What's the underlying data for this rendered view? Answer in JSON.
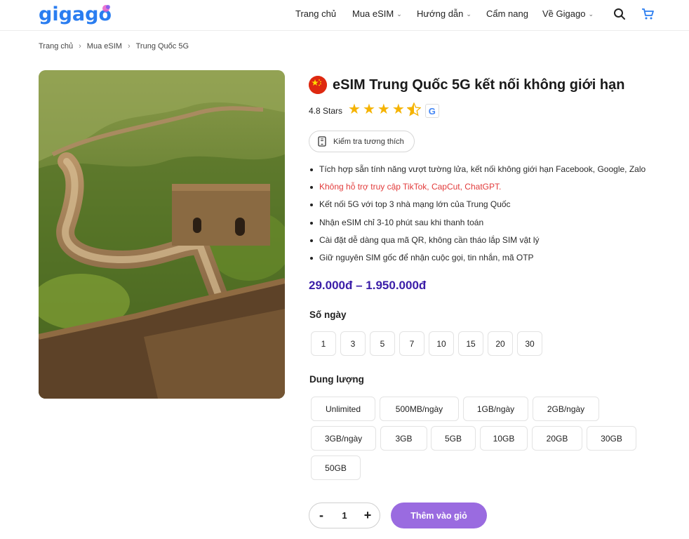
{
  "header": {
    "logo_text": "gigago",
    "nav": [
      {
        "label": "Trang chủ",
        "has_dropdown": false
      },
      {
        "label": "Mua eSIM",
        "has_dropdown": true
      },
      {
        "label": "Hướng dẫn",
        "has_dropdown": true
      },
      {
        "label": "Cẩm nang",
        "has_dropdown": false
      },
      {
        "label": "Về Gigago",
        "has_dropdown": true
      }
    ],
    "icons": [
      "search-icon",
      "cart-icon"
    ]
  },
  "breadcrumb": [
    "Trang chủ",
    "Mua eSIM",
    "Trung Quốc 5G"
  ],
  "product": {
    "flag_icon": "china-flag-icon",
    "title": "eSIM Trung Quốc 5G kết nối không giới hạn",
    "rating_text": "4.8 Stars",
    "rating_value": 4.8,
    "rating_max": 5,
    "compat_button": "Kiểm tra tương thích",
    "features": [
      {
        "text": "Tích hợp sẵn tính năng vượt tường lửa, kết nối không giới hạn Facebook, Google, Zalo",
        "warn": false
      },
      {
        "text": "Không hỗ trợ truy cập TikTok, CapCut, ChatGPT.",
        "warn": true
      },
      {
        "text": "Kết nối 5G với top 3 nhà mạng lớn của Trung Quốc",
        "warn": false
      },
      {
        "text": "Nhận eSIM chỉ 3-10 phút sau khi thanh toán",
        "warn": false
      },
      {
        "text": "Cài đặt dễ dàng qua mã QR, không cần tháo lắp SIM vật lý",
        "warn": false
      },
      {
        "text": "Giữ nguyên SIM gốc để nhận cuộc gọi, tin nhắn, mã OTP",
        "warn": false
      }
    ],
    "price": "29.000đ – 1.950.000đ",
    "days_label": "Số ngày",
    "days_options": [
      "1",
      "3",
      "5",
      "7",
      "10",
      "15",
      "20",
      "30"
    ],
    "data_label": "Dung lượng",
    "data_options": [
      "Unlimited",
      "500MB/ngày",
      "1GB/ngày",
      "2GB/ngày",
      "3GB/ngày",
      "3GB",
      "5GB",
      "10GB",
      "20GB",
      "30GB",
      "50GB"
    ],
    "quantity": "1",
    "qty_minus": "-",
    "qty_plus": "+",
    "add_to_cart": "Thêm vào giỏ"
  },
  "colors": {
    "brand_blue": "#2a7df0",
    "price_purple": "#3b1ea8",
    "button_purple": "#9a6be0",
    "warning_red": "#e23b3b",
    "star_yellow": "#f5b301"
  }
}
